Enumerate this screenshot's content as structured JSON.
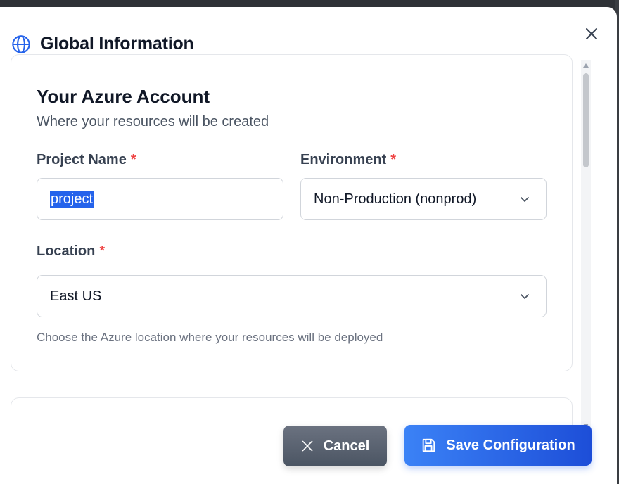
{
  "modal": {
    "title": "Global Information",
    "title_icon": "globe-icon",
    "close_icon": "close-icon"
  },
  "account_card": {
    "title": "Your Azure Account",
    "subtitle": "Where your resources will be created",
    "required_marker": "*",
    "project_name": {
      "label": "Project Name",
      "value": "project"
    },
    "environment": {
      "label": "Environment",
      "selected": "Non-Production (nonprod)"
    },
    "location": {
      "label": "Location",
      "selected": "East US",
      "hint": "Choose the Azure location where your resources will be deployed"
    }
  },
  "footer": {
    "cancel_label": "Cancel",
    "cancel_icon": "x-icon",
    "save_label": "Save Configuration",
    "save_icon": "floppy-disk-icon"
  },
  "colors": {
    "accent": "#2563eb",
    "required": "#ef4444",
    "cancel_bg": "#4b5563"
  }
}
